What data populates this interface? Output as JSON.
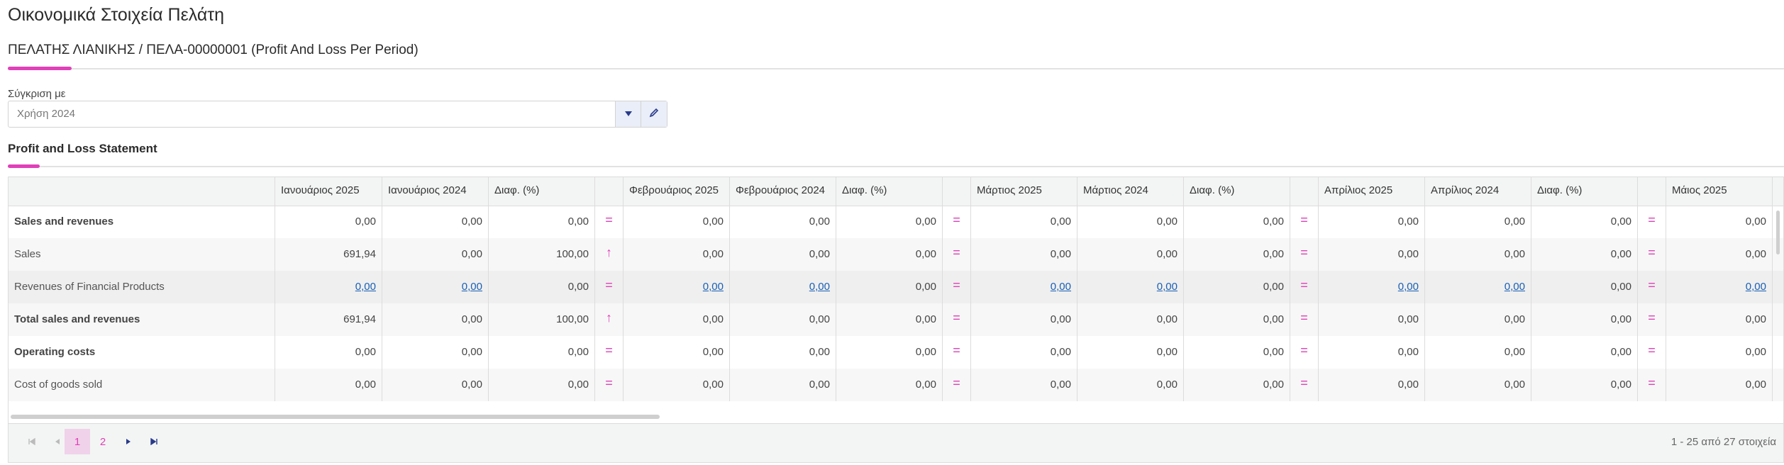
{
  "page": {
    "title": "Οικονομικά Στοιχεία Πελάτη",
    "subheader": "ΠΕΛΑΤΗΣ ΛΙΑΝΙΚΗΣ / ΠΕΛΑ-00000001 (Profit And Loss Per Period)"
  },
  "compare": {
    "label": "Σύγκριση με",
    "value": "Χρήση 2024"
  },
  "section": {
    "title": "Profit and Loss Statement"
  },
  "colors": {
    "accent": "#e040b8",
    "link": "#1a5fb4"
  },
  "grid": {
    "columns": [
      "",
      "Ιανουάριος 2025",
      "Ιανουάριος 2024",
      "Διαφ. (%)",
      "",
      "Φεβρουάριος 2025",
      "Φεβρουάριος 2024",
      "Διαφ. (%)",
      "",
      "Μάρτιος 2025",
      "Μάρτιος 2024",
      "Διαφ. (%)",
      "",
      "Απρίλιος 2025",
      "Απρίλιος 2024",
      "Διαφ. (%)",
      "",
      "Μάιος 2025",
      ""
    ],
    "rows": [
      {
        "label": "Sales and revenues",
        "bold": true,
        "link": false,
        "values": [
          "0,00",
          "0,00",
          "0,00",
          "=",
          "0,00",
          "0,00",
          "0,00",
          "=",
          "0,00",
          "0,00",
          "0,00",
          "=",
          "0,00",
          "0,00",
          "0,00",
          "=",
          "0,00"
        ]
      },
      {
        "label": "Sales",
        "bold": false,
        "link": false,
        "values": [
          "691,94",
          "0,00",
          "100,00",
          "↑",
          "0,00",
          "0,00",
          "0,00",
          "=",
          "0,00",
          "0,00",
          "0,00",
          "=",
          "0,00",
          "0,00",
          "0,00",
          "=",
          "0,00"
        ]
      },
      {
        "label": "Revenues of Financial Products",
        "bold": false,
        "link": true,
        "values": [
          "0,00",
          "0,00",
          "0,00",
          "=",
          "0,00",
          "0,00",
          "0,00",
          "=",
          "0,00",
          "0,00",
          "0,00",
          "=",
          "0,00",
          "0,00",
          "0,00",
          "=",
          "0,00"
        ]
      },
      {
        "label": "Total sales and revenues",
        "bold": true,
        "link": false,
        "values": [
          "691,94",
          "0,00",
          "100,00",
          "↑",
          "0,00",
          "0,00",
          "0,00",
          "=",
          "0,00",
          "0,00",
          "0,00",
          "=",
          "0,00",
          "0,00",
          "0,00",
          "=",
          "0,00"
        ]
      },
      {
        "label": "Operating costs",
        "bold": true,
        "link": false,
        "values": [
          "0,00",
          "0,00",
          "0,00",
          "=",
          "0,00",
          "0,00",
          "0,00",
          "=",
          "0,00",
          "0,00",
          "0,00",
          "=",
          "0,00",
          "0,00",
          "0,00",
          "=",
          "0,00"
        ]
      },
      {
        "label": "Cost of goods sold",
        "bold": false,
        "link": false,
        "values": [
          "0,00",
          "0,00",
          "0,00",
          "=",
          "0,00",
          "0,00",
          "0,00",
          "=",
          "0,00",
          "0,00",
          "0,00",
          "=",
          "0,00",
          "0,00",
          "0,00",
          "=",
          "0,00"
        ]
      }
    ]
  },
  "pager": {
    "pages": [
      "1",
      "2"
    ],
    "current": "1",
    "info": "1 - 25 από 27 στοιχεία"
  }
}
